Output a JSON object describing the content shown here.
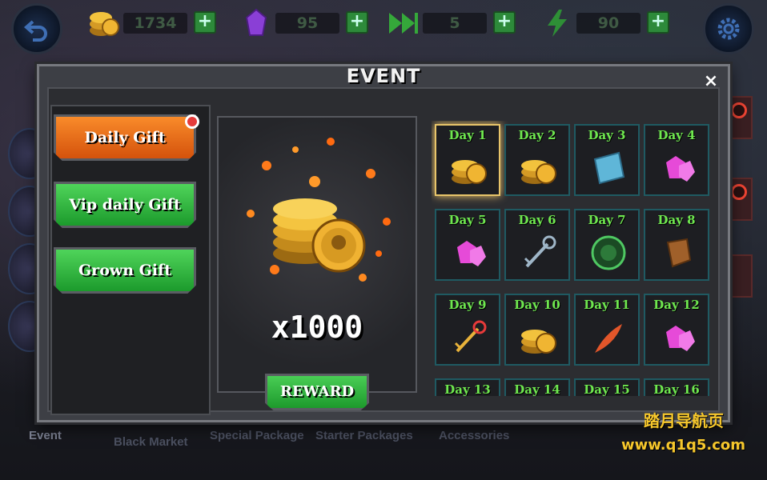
{
  "resources": {
    "gold": "1734",
    "gems": "95",
    "skips": "5",
    "energy": "90",
    "plus": "+"
  },
  "bottom_tabs": [
    "Event",
    "Black Market",
    "Special Package",
    "Starter Packages",
    "Accessories"
  ],
  "dialog": {
    "title": "EVENT",
    "close": "×"
  },
  "menu": {
    "items": [
      {
        "label": "Daily Gift"
      },
      {
        "label": "Vip daily Gift"
      },
      {
        "label": "Grown Gift"
      }
    ]
  },
  "reward": {
    "quantity": "x1000",
    "button": "REWARD",
    "item_icon": "gold-coins-icon"
  },
  "days": [
    {
      "label": "Day 1",
      "icon": "gold-coins-icon"
    },
    {
      "label": "Day 2",
      "icon": "gold-coins-icon"
    },
    {
      "label": "Day 3",
      "icon": "scroll-icon"
    },
    {
      "label": "Day 4",
      "icon": "gem-icon"
    },
    {
      "label": "Day 5",
      "icon": "gem-icon"
    },
    {
      "label": "Day 6",
      "icon": "key-icon"
    },
    {
      "label": "Day 7",
      "icon": "green-orb-icon"
    },
    {
      "label": "Day 8",
      "icon": "leather-icon"
    },
    {
      "label": "Day 9",
      "icon": "key-icon"
    },
    {
      "label": "Day 10",
      "icon": "gold-coins-icon"
    },
    {
      "label": "Day 11",
      "icon": "feather-icon"
    },
    {
      "label": "Day 12",
      "icon": "gem-icon"
    },
    {
      "label": "Day 13",
      "icon": ""
    },
    {
      "label": "Day 14",
      "icon": ""
    },
    {
      "label": "Day 15",
      "icon": ""
    },
    {
      "label": "Day 16",
      "icon": ""
    }
  ],
  "watermark": {
    "line1": "踏月导航页",
    "line2": "www.q1q5.com"
  },
  "colors": {
    "day_label": "#6fe84f",
    "active_border": "#e8c56a",
    "orange_button": "#f98b2a",
    "green_button": "#2fb53e",
    "badge": "#e53b3b"
  }
}
